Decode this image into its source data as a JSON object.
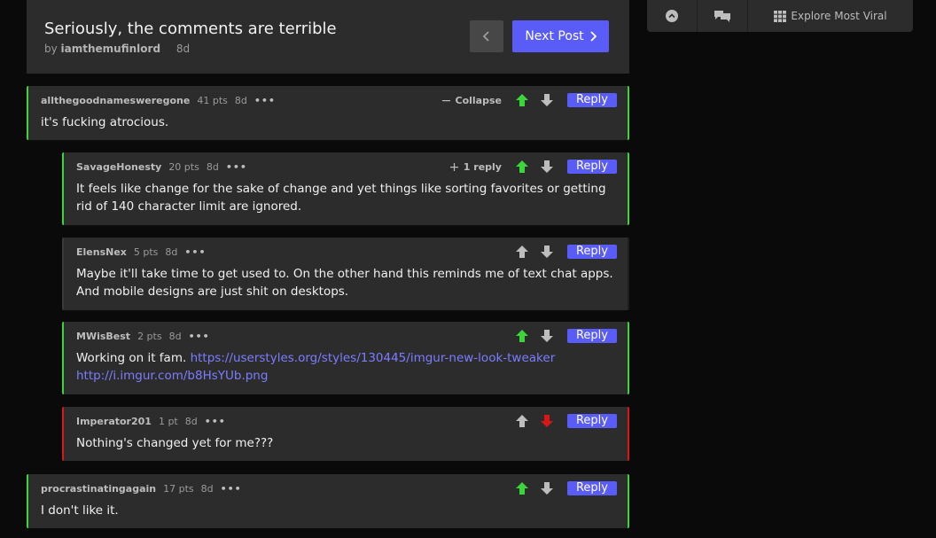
{
  "post": {
    "title": "Seriously, the comments are terrible",
    "by_label": "by",
    "author": "iamthemufinlord",
    "age": "8d",
    "next_label": "Next Post"
  },
  "sidebar": {
    "explore_label": "Explore Most Viral"
  },
  "comments": [
    {
      "user": "allthegoodnamesweregone",
      "points": "41 pts",
      "age": "8d",
      "aux_label": "Collapse",
      "aux_icon": "minus",
      "text": "it's fucking atrocious.",
      "vote": "up",
      "reply_label": "Reply"
    },
    {
      "user": "SavageHonesty",
      "points": "20 pts",
      "age": "8d",
      "aux_label": "1 reply",
      "aux_icon": "plus",
      "text": "It feels like change for the sake of change and yet things like sorting favorites or getting rid of 140 character limit are ignored.",
      "vote": "up",
      "reply_label": "Reply"
    },
    {
      "user": "ElensNex",
      "points": "5 pts",
      "age": "8d",
      "text": "Maybe it'll take time to get used to. On the other hand this reminds me of text chat apps. And mobile designs are just shit on desktops.",
      "vote": "none",
      "reply_label": "Reply"
    },
    {
      "user": "MWisBest",
      "points": "2 pts",
      "age": "8d",
      "text_prefix": "Working on it fam.",
      "link1": "https://userstyles.org/styles/130445/imgur-new-look-tweaker",
      "link2": "http://i.imgur.com/b8HsYUb.png",
      "vote": "up",
      "reply_label": "Reply"
    },
    {
      "user": "Imperator201",
      "points": "1 pt",
      "age": "8d",
      "text": "Nothing's changed yet for me???",
      "vote": "down",
      "reply_label": "Reply"
    },
    {
      "user": "procrastinatingagain",
      "points": "17 pts",
      "age": "8d",
      "text": "I don't like it.",
      "vote": "up",
      "reply_label": "Reply"
    }
  ],
  "more_glyph": "•••",
  "colors": {
    "accent": "#5a5cf7",
    "upvote": "#3ad63a",
    "downvote": "#d81818",
    "neutral_vote": "#bdbdbd"
  }
}
